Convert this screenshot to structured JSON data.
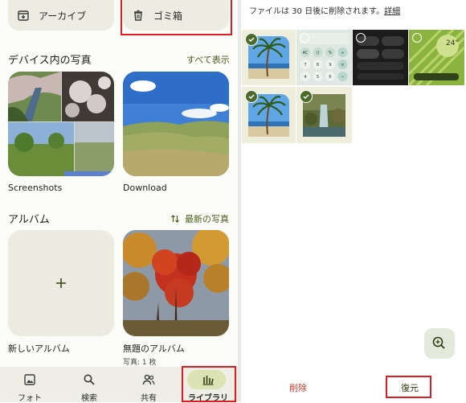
{
  "left": {
    "archive_label": "アーカイブ",
    "trash_label": "ゴミ箱",
    "device_photos_title": "デバイス内の写真",
    "show_all_label": "すべて表示",
    "folders": [
      {
        "name": "Screenshots"
      },
      {
        "name": "Download"
      }
    ],
    "albums_title": "アルバム",
    "recent_photos_label": "最新の写真",
    "albums": [
      {
        "name": "新しいアルバム",
        "count": ""
      },
      {
        "name": "無題のアルバム",
        "count": "写真: 1 枚"
      }
    ],
    "nav": [
      {
        "label": "フォト",
        "icon": "photo-icon"
      },
      {
        "label": "検索",
        "icon": "search-icon"
      },
      {
        "label": "共有",
        "icon": "people-icon"
      },
      {
        "label": "ライブラリ",
        "icon": "library-icon",
        "active": true
      }
    ]
  },
  "right": {
    "notice_text": "ファイルは 30 日後に削除されます。",
    "notice_link": "詳細",
    "delete_label": "削除",
    "restore_label": "復元",
    "zoom_icon": "zoom-in-icon",
    "calc_keys": [
      "AC",
      "()",
      "%",
      "÷",
      "7",
      "8",
      "9",
      "×",
      "4",
      "5",
      "6",
      "−"
    ],
    "clock_text": "24°"
  },
  "colors": {
    "accent_red": "#e11b22",
    "nav_active": "#dbe3b5",
    "check_green": "#4c6b2a"
  }
}
